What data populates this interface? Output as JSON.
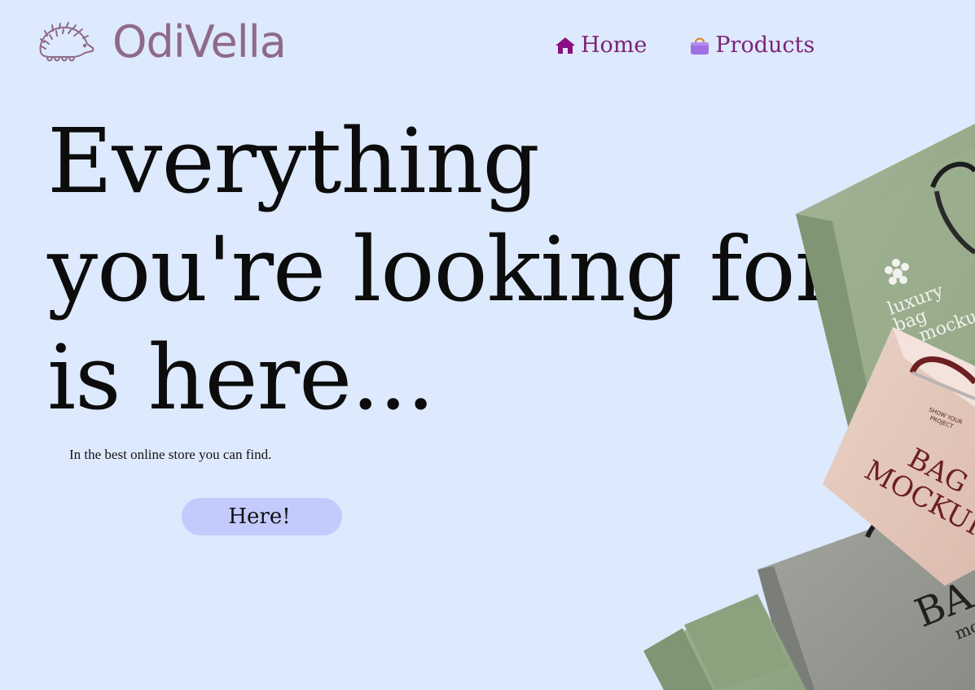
{
  "brand": {
    "name": "OdiVella",
    "logo_icon": "hedgehog-icon"
  },
  "nav": {
    "items": [
      {
        "label": "Home",
        "icon": "home-icon"
      },
      {
        "label": "Products",
        "icon": "shopping-bag-icon"
      }
    ]
  },
  "hero": {
    "title_lines": [
      "Everything",
      "you're looking for",
      "is here..."
    ],
    "subtitle": "In the best online store you can find.",
    "cta_label": "Here!"
  },
  "bags_image": {
    "green_bag": {
      "lines": [
        "luxury",
        "bag",
        "mockup"
      ]
    },
    "pink_bag": {
      "small_lines": [
        "SHOW YOUR",
        "PROJECT"
      ],
      "lines": [
        "BAG",
        "MOCKUP"
      ]
    },
    "grey_bag": {
      "lines": [
        "BA",
        "moc"
      ]
    }
  },
  "colors": {
    "background": "#dde9fd",
    "brand": "#8f6a88",
    "nav_text": "#7b2475",
    "nav_home_icon": "#8a0f85",
    "nav_products_icon": "#9d6fe0",
    "cta_bg": "#c2cbfb"
  }
}
